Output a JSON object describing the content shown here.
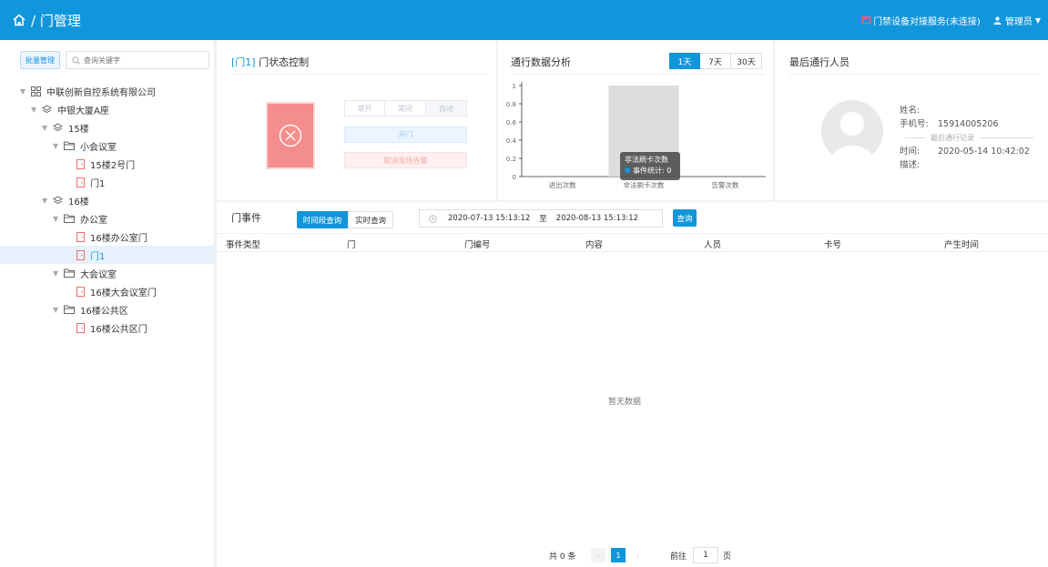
{
  "header": {
    "breadcrumb": "/ 门管理",
    "service_status": "门禁设备对接服务(未连接)",
    "user": "管理员"
  },
  "sidebar": {
    "batch_button": "批量管理",
    "search_placeholder": "查询关键字",
    "tree": [
      {
        "label": "中联创新自控系统有限公司",
        "type": "org"
      },
      {
        "label": "中银大厦A座",
        "type": "building"
      },
      {
        "label": "15楼",
        "type": "floor"
      },
      {
        "label": "小会议室",
        "type": "room"
      },
      {
        "label": "15楼2号门",
        "type": "door"
      },
      {
        "label": "门1",
        "type": "door"
      },
      {
        "label": "16楼",
        "type": "floor"
      },
      {
        "label": "办公室",
        "type": "room"
      },
      {
        "label": "16楼办公室门",
        "type": "door"
      },
      {
        "label": "门1",
        "type": "door",
        "selected": true
      },
      {
        "label": "大会议室",
        "type": "room"
      },
      {
        "label": "16楼大会议室门",
        "type": "door"
      },
      {
        "label": "16楼公共区",
        "type": "room"
      },
      {
        "label": "16楼公共区门",
        "type": "door"
      }
    ]
  },
  "door_panel": {
    "title_prefix": "[门1]",
    "title": "门状态控制",
    "modes": [
      "常开",
      "常闭",
      "自动"
    ],
    "open_button": "开门",
    "cancel_alarm_button": "取消现场告警"
  },
  "traffic_panel": {
    "title": "通行数据分析",
    "ranges": [
      "1天",
      "7天",
      "30天"
    ],
    "tooltip_title": "非法刷卡次数",
    "tooltip_value": "事件统计: 0"
  },
  "chart_data": {
    "type": "bar",
    "categories": [
      "进出次数",
      "非法刷卡次数",
      "告警次数"
    ],
    "series": [
      {
        "name": "事件统计",
        "values": [
          0,
          0,
          0
        ]
      }
    ],
    "ylim": [
      0,
      1
    ],
    "yticks": [
      "0",
      "0.2",
      "0.4",
      "0.6",
      "0.8",
      "1"
    ],
    "highlighted_category": 1
  },
  "last_person": {
    "title": "最后通行人员",
    "name_label": "姓名:",
    "name": "",
    "phone_label": "手机号:",
    "phone": "15914005206",
    "records_link": "最后通行记录",
    "time_label": "时间:",
    "time": "2020-05-14 10:42:02",
    "desc_label": "描述:",
    "desc": ""
  },
  "events": {
    "title": "门事件",
    "time_query": "时间段查询",
    "realtime_query": "实时查询",
    "start": "2020-07-13 15:13:12",
    "to": "至",
    "end": "2020-08-13 15:13:12",
    "query_button": "查询",
    "columns": [
      "事件类型",
      "门",
      "门编号",
      "内容",
      "人员",
      "卡号",
      "产生时间"
    ],
    "empty_text": "暂无数据"
  },
  "pager": {
    "total": "共 0 条",
    "current_page": "1",
    "goto_label": "前往",
    "goto_value": "1",
    "unit": "页"
  }
}
